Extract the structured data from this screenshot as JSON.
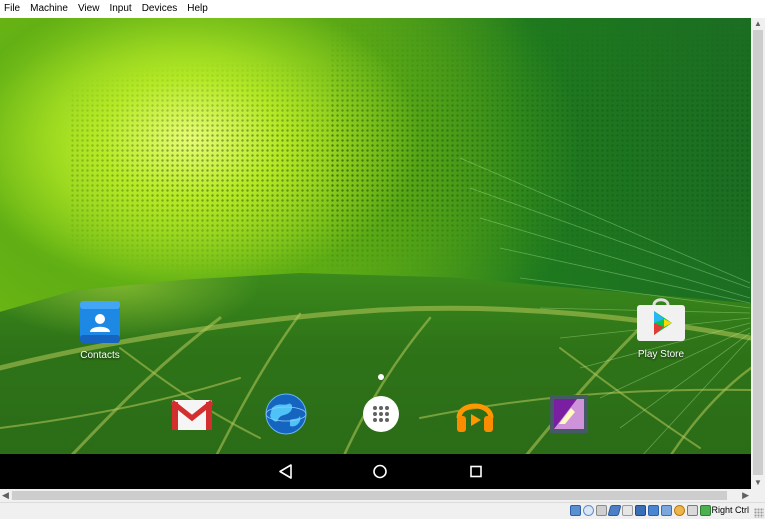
{
  "menu": {
    "items": [
      "File",
      "Machine",
      "View",
      "Input",
      "Devices",
      "Help"
    ]
  },
  "home": {
    "apps": [
      {
        "label": "Contacts",
        "icon": "contacts-icon"
      },
      {
        "label": "Play Store",
        "icon": "play-store-icon"
      }
    ],
    "dock": [
      {
        "icon": "gmail-icon"
      },
      {
        "icon": "browser-globe-icon"
      },
      {
        "icon": "app-drawer-icon"
      },
      {
        "icon": "play-music-icon"
      },
      {
        "icon": "gallery-icon"
      }
    ],
    "page_indicator": {
      "pages": 1,
      "current": 1
    }
  },
  "navbar": {
    "buttons": [
      "back-icon",
      "home-icon",
      "recents-icon"
    ]
  },
  "statusbar": {
    "host_key_label": "Right Ctrl",
    "indicators": [
      "hard-disk-icon",
      "optical-drive-icon",
      "audio-icon",
      "usb-icon",
      "shared-folders-icon",
      "display-icon",
      "network-icon",
      "recording-icon",
      "cpu-icon",
      "mouse-integration-icon",
      "keyboard-capture-icon"
    ]
  },
  "colors": {
    "navbar": "#000000",
    "wallpaper_green": "#2a6f1e",
    "wallpaper_highlight": "#c8f03c"
  }
}
